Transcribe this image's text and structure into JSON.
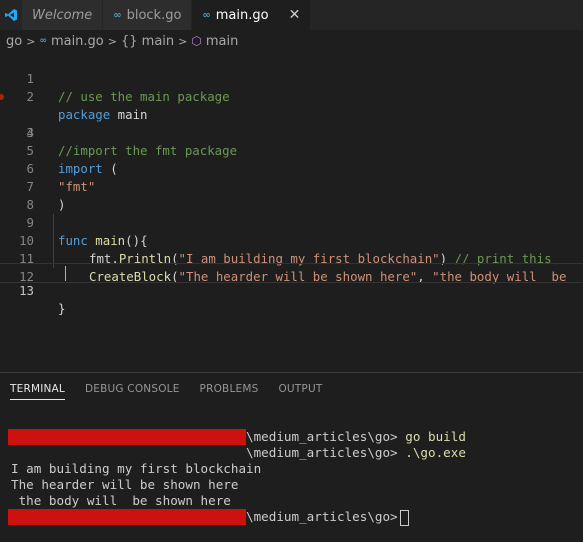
{
  "tabs": [
    {
      "label": "Welcome"
    },
    {
      "label": "block.go"
    },
    {
      "label": "main.go"
    }
  ],
  "tab_close_symbol": "✕",
  "breadcrumb": {
    "folder": "go",
    "file": "main.go",
    "scope": "{} main",
    "symbol": "main"
  },
  "editor": {
    "lines": [
      {
        "n": "1"
      },
      {
        "n": "2"
      },
      {
        "n": "3"
      },
      {
        "n": "4"
      },
      {
        "n": "5"
      },
      {
        "n": "6"
      },
      {
        "n": "7"
      },
      {
        "n": "8"
      },
      {
        "n": "9"
      },
      {
        "n": "10"
      },
      {
        "n": "11"
      },
      {
        "n": "12"
      },
      {
        "n": "13"
      }
    ],
    "code": {
      "l1": "// use the main package",
      "l2_kw": "package",
      "l2_rest": " main",
      "l4": "//import the fmt package",
      "l5_kw": "import",
      "l5_rest": " (",
      "l6": "\"fmt\"",
      "l7": ")",
      "l9_kw": "func",
      "l9_fn": " main",
      "l9_rest": "(){",
      "l10_obj": "fmt.",
      "l10_fn": "Println",
      "l10_open": "(",
      "l10_str": "\"I am building my first blockchain\"",
      "l10_close": ")",
      "l10_cm": " // print this",
      "l11_fn": "CreateBlock",
      "l11_open": "(",
      "l11_str1": "\"The hearder will be shown here\"",
      "l11_comma": ", ",
      "l11_str2": "\"the body will  be",
      "l13": "}"
    }
  },
  "panel": {
    "tabs": [
      "TERMINAL",
      "DEBUG CONSOLE",
      "PROBLEMS",
      "OUTPUT"
    ],
    "active_tab": "TERMINAL"
  },
  "terminal": {
    "line1_path": "\\medium_articles\\go>",
    "line1_cmd": " go build",
    "line2_path": "\\medium_articles\\go>",
    "line2_cmd": " .\\go.exe",
    "line3": "I am building my first blockchain",
    "line4": "The hearder will be shown here",
    "line5": " the body will  be shown here",
    "line6_path": "\\medium_articles\\go>"
  },
  "colors": {
    "editor_bg": "#1e1e1e",
    "keyword": "#569cd6",
    "string": "#ce9178",
    "comment": "#6a9955",
    "function": "#dcdcaa",
    "redaction": "#cc1111"
  }
}
